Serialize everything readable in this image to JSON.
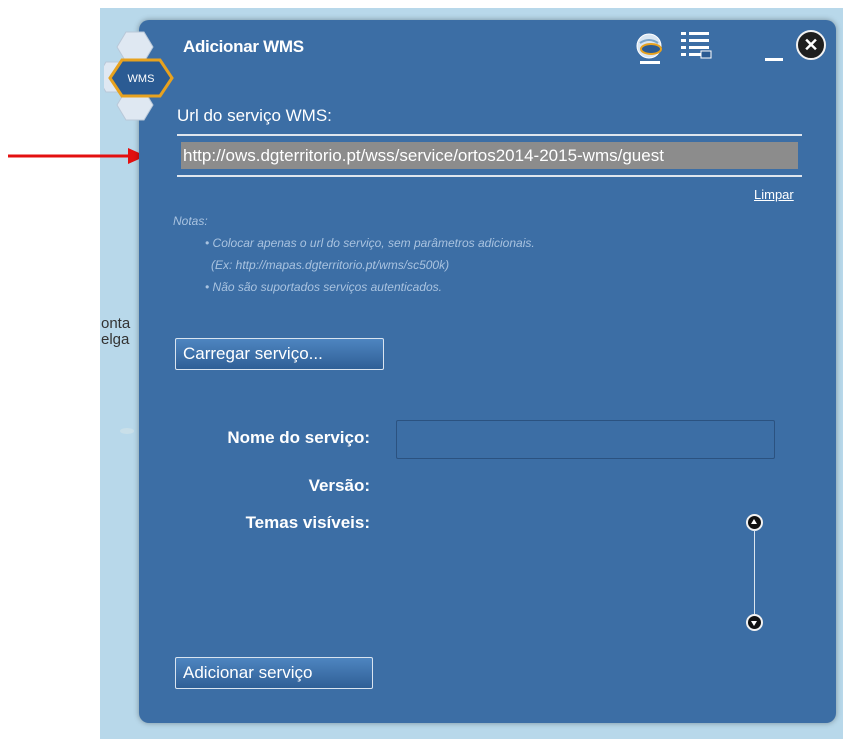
{
  "window": {
    "title": "Adicionar WMS",
    "badge_text": "WMS",
    "close_glyph": "✕"
  },
  "map": {
    "labels": [
      "onta",
      "elga"
    ]
  },
  "form": {
    "url_label": "Url do serviço WMS:",
    "url_value": "http://ows.dgterritorio.pt/wss/service/ortos2014-2015-wms/guest",
    "clear_link": "Limpar",
    "notes": {
      "heading": "Notas:",
      "lines": [
        "• Colocar apenas o url do serviço, sem parâmetros adicionais.",
        "(Ex: http://mapas.dgterritorio.pt/wms/sc500k)",
        "• Não são suportados serviços autenticados."
      ]
    },
    "load_button": "Carregar serviço...",
    "service_name_label": "Nome do serviço:",
    "service_name_value": "",
    "version_label": "Versão:",
    "visible_themes_label": "Temas visíveis:",
    "add_button": "Adicionar serviço"
  },
  "icons": {
    "header": [
      "wms-globe-icon",
      "layer-list-icon",
      "minimize-icon",
      "close-icon"
    ],
    "scroll": [
      "scroll-up-icon",
      "scroll-down-icon"
    ]
  },
  "colors": {
    "panel": "#3c6ea5",
    "annotation_arrow": "#e31010",
    "input_highlight": "#8c8c8c"
  }
}
